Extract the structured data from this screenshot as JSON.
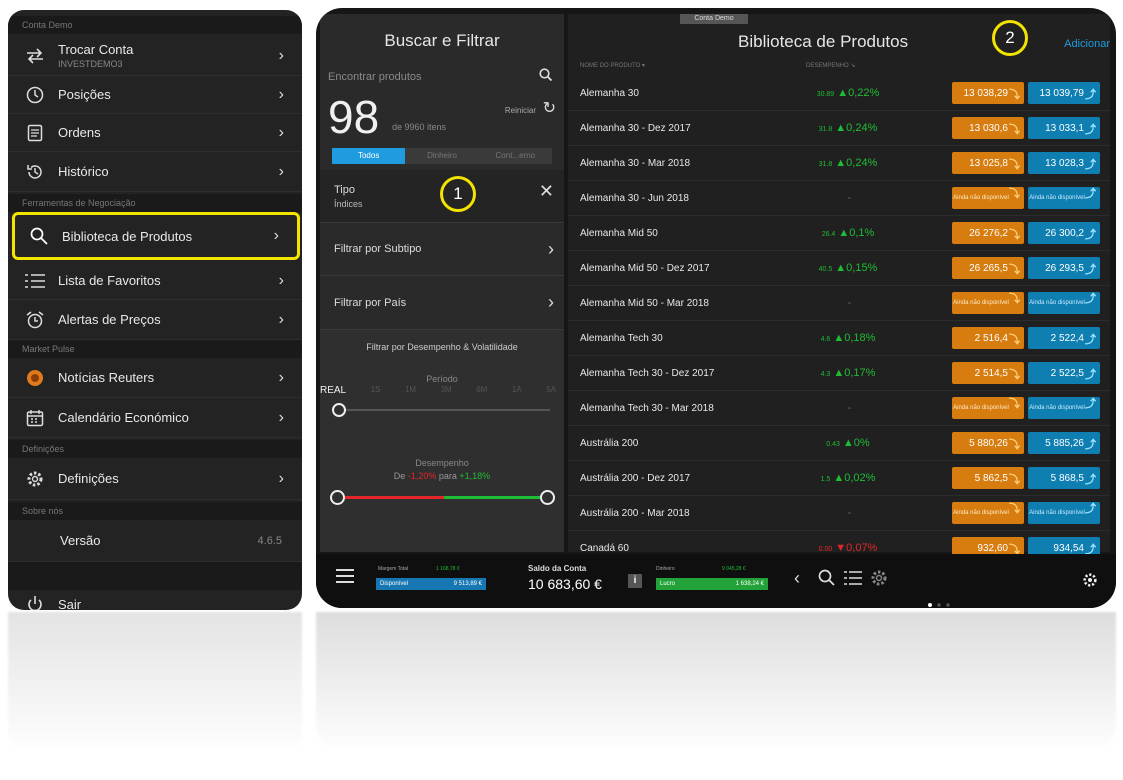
{
  "menu": {
    "demo_account_header": "Conta Demo",
    "switch_account": {
      "label": "Trocar Conta",
      "sub": "INVESTDEMO3"
    },
    "positions": "Posições",
    "orders": "Ordens",
    "history": "Histórico",
    "trading_tools_header": "Ferramentas de Negociação",
    "product_library": "Biblioteca de Produtos",
    "watchlist": "Lista de Favoritos",
    "price_alerts": "Alertas de Preços",
    "market_pulse_header": "Market Pulse",
    "reuters_news": "Notícias Reuters",
    "economic_calendar": "Calendário Económico",
    "definitions_header": "Definições",
    "definitions": "Definições",
    "about_header": "Sobre nós",
    "version_label": "Versão",
    "version_value": "4.6.5",
    "logout": "Sair"
  },
  "search": {
    "title": "Buscar e Filtrar",
    "placeholder": "Encontrar produtos",
    "count": "98",
    "count_suffix": "de 9960 itens",
    "reset": "Reiniciar",
    "tabs": [
      "Todos",
      "Dinheiro",
      "Cont...erno"
    ],
    "type_label": "Tipo",
    "type_value": "Índices",
    "filter_subtype": "Filtrar por Subtipo",
    "filter_country": "Filtrar por País",
    "perf_header": "Filtrar por Desempenho & Volatilidade",
    "period_label": "Período",
    "period_ticks": [
      "REAL",
      "1S",
      "1M",
      "3M",
      "6M",
      "1A",
      "5A"
    ],
    "perf_label": "Desempenho",
    "perf_from_word": "De",
    "perf_from_value": "-1,20%",
    "perf_to_word": "para",
    "perf_to_value": "+1,18%"
  },
  "library": {
    "demo_tag": "Conta Demo",
    "title": "Biblioteca de Produtos",
    "add": "Adicionar",
    "col_name": "NOME DO PRODUTO ▾",
    "col_perf": "DESEMPENHO ↘",
    "na_text": "Ainda não disponível",
    "rows": [
      {
        "name": "Alemanha 30",
        "perf_small": "30.89",
        "perf": "▲0,22%",
        "dir": "up",
        "sell": "13 038,29",
        "buy": "13 039,79"
      },
      {
        "name": "Alemanha 30 - Dez 2017",
        "perf_small": "31.8",
        "perf": "▲0,24%",
        "dir": "up",
        "sell": "13 030,6",
        "buy": "13 033,1"
      },
      {
        "name": "Alemanha 30 - Mar 2018",
        "perf_small": "31.8",
        "perf": "▲0,24%",
        "dir": "up",
        "sell": "13 025,8",
        "buy": "13 028,3"
      },
      {
        "name": "Alemanha 30 - Jun 2018",
        "perf_small": "",
        "perf": "-",
        "dir": "none",
        "sell": "",
        "buy": ""
      },
      {
        "name": "Alemanha Mid 50",
        "perf_small": "26.4",
        "perf": "▲0,1%",
        "dir": "up",
        "sell": "26 276,2",
        "buy": "26 300,2"
      },
      {
        "name": "Alemanha Mid 50 - Dez 2017",
        "perf_small": "40.5",
        "perf": "▲0,15%",
        "dir": "up",
        "sell": "26 265,5",
        "buy": "26 293,5"
      },
      {
        "name": "Alemanha Mid 50 - Mar 2018",
        "perf_small": "",
        "perf": "-",
        "dir": "none",
        "sell": "",
        "buy": ""
      },
      {
        "name": "Alemanha Tech 30",
        "perf_small": "4.6",
        "perf": "▲0,18%",
        "dir": "up",
        "sell": "2 516,4",
        "buy": "2 522,4"
      },
      {
        "name": "Alemanha Tech 30 - Dez 2017",
        "perf_small": "4.3",
        "perf": "▲0,17%",
        "dir": "up",
        "sell": "2 514,5",
        "buy": "2 522,5"
      },
      {
        "name": "Alemanha Tech 30 - Mar 2018",
        "perf_small": "",
        "perf": "-",
        "dir": "none",
        "sell": "",
        "buy": ""
      },
      {
        "name": "Austrália 200",
        "perf_small": "0.43",
        "perf": "▲0%",
        "dir": "up",
        "sell": "5 880,26",
        "buy": "5 885,26"
      },
      {
        "name": "Austrália 200 - Dez 2017",
        "perf_small": "1.5",
        "perf": "▲0,02%",
        "dir": "up",
        "sell": "5 862,5",
        "buy": "5 868,5"
      },
      {
        "name": "Austrália 200 - Mar 2018",
        "perf_small": "",
        "perf": "-",
        "dir": "none",
        "sell": "",
        "buy": ""
      },
      {
        "name": "Canadá 60",
        "perf_small": "0.00",
        "perf": "▼0,07%",
        "dir": "down",
        "sell": "932,60",
        "buy": "934,54"
      }
    ]
  },
  "bottom": {
    "total_margin_label": "Margem Total",
    "total_margin_value": "1 168,78 €",
    "available_label": "Disponível",
    "available_value": "9 513,89 €",
    "balance_label": "Saldo da Conta",
    "balance_value": "10 683,60 €",
    "money_label": "Dinheiro",
    "money_value": "9 045,28 €",
    "profit_label": "Lucro",
    "profit_value": "1 638,24 €"
  },
  "annotations": {
    "one": "1",
    "two": "2"
  },
  "colors": {
    "highlight": "#f3e300",
    "sell": "#d77d10",
    "buy": "#0f7fb2",
    "up": "#1fbd35",
    "down": "#e3262a",
    "tab_active": "#1f9be0"
  }
}
